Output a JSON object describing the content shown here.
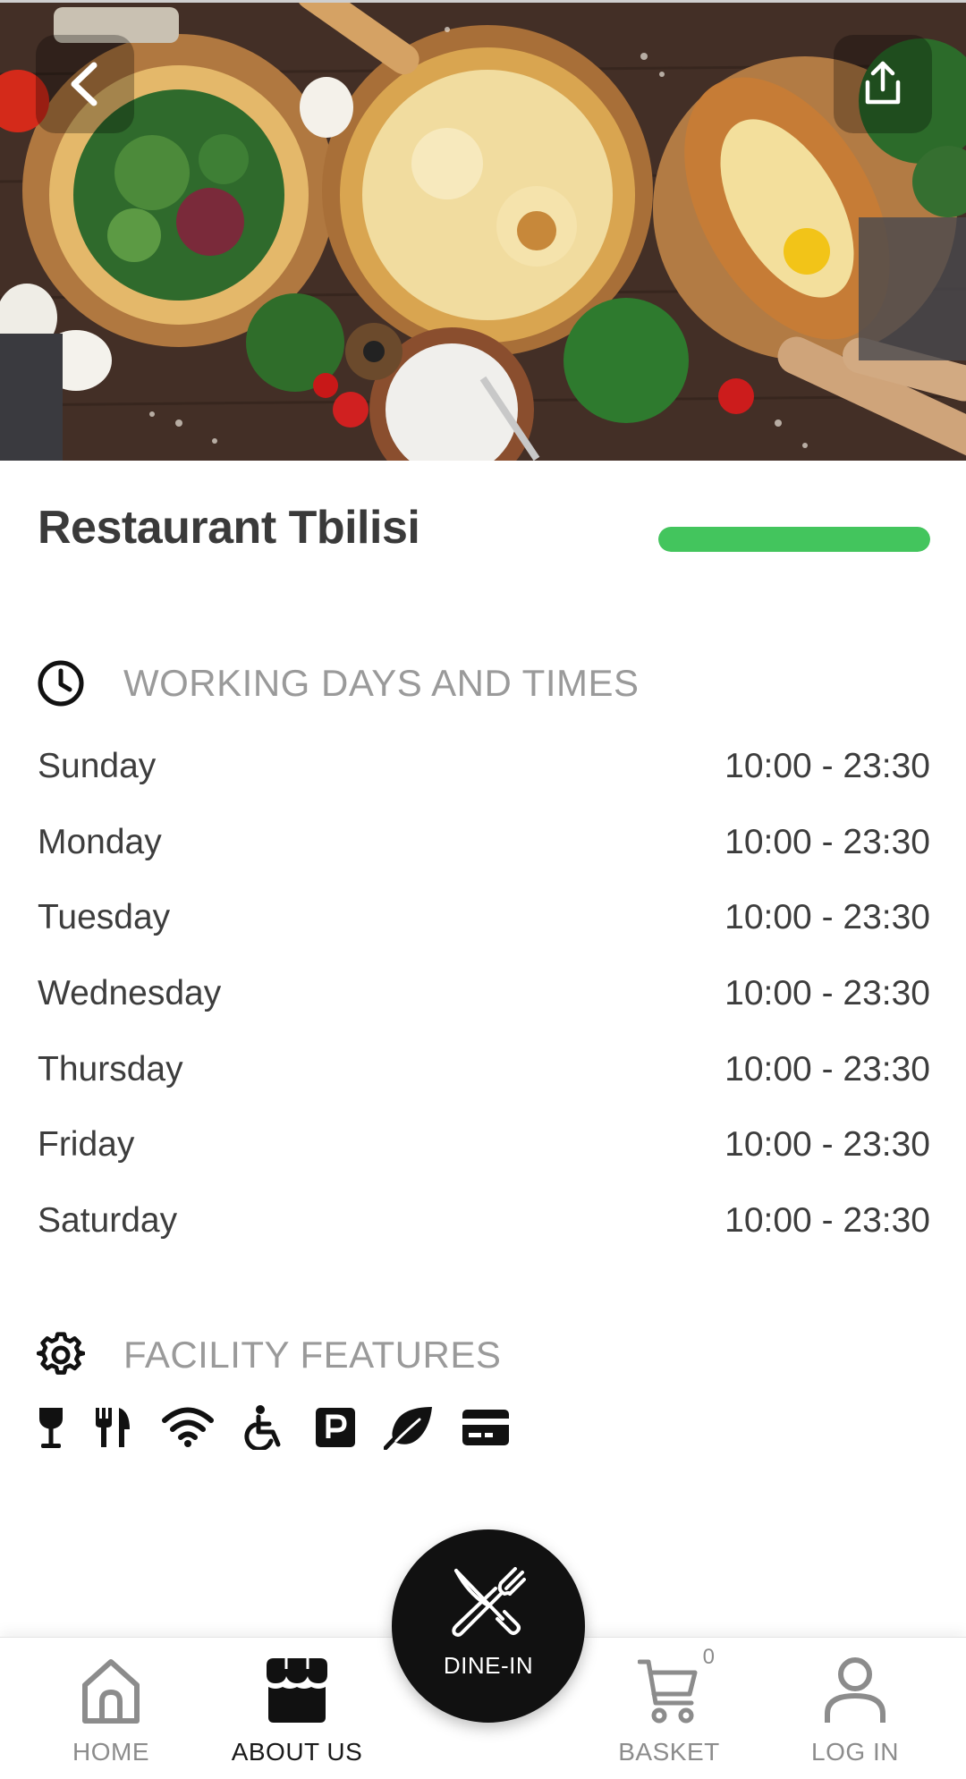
{
  "restaurant": {
    "name": "Restaurant Tbilisi",
    "status_color": "#43c55d",
    "status_fill": 1.0
  },
  "hero": {
    "back_icon": "chevron-left-icon",
    "share_icon": "share-icon"
  },
  "working_hours": {
    "icon": "clock-icon",
    "title": "WORKING DAYS AND TIMES",
    "days": [
      {
        "day": "Sunday",
        "hours": "10:00 - 23:30"
      },
      {
        "day": "Monday",
        "hours": "10:00 - 23:30"
      },
      {
        "day": "Tuesday",
        "hours": "10:00 - 23:30"
      },
      {
        "day": "Wednesday",
        "hours": "10:00 - 23:30"
      },
      {
        "day": "Thursday",
        "hours": "10:00 - 23:30"
      },
      {
        "day": "Friday",
        "hours": "10:00 - 23:30"
      },
      {
        "day": "Saturday",
        "hours": "10:00 - 23:30"
      }
    ]
  },
  "facility": {
    "icon": "gear-icon",
    "title": "FACILITY FEATURES",
    "features": [
      "wine-glass-icon",
      "fork-knife-icon",
      "wifi-icon",
      "wheelchair-icon",
      "parking-icon",
      "leaf-icon",
      "credit-card-icon"
    ]
  },
  "nav": {
    "home": "HOME",
    "about": "ABOUT US",
    "dine_in": "DINE-IN",
    "basket": "BASKET",
    "basket_count": "0",
    "login": "LOG IN",
    "active_color": "#1a1a1a",
    "inactive_color": "#8c8c8c"
  }
}
